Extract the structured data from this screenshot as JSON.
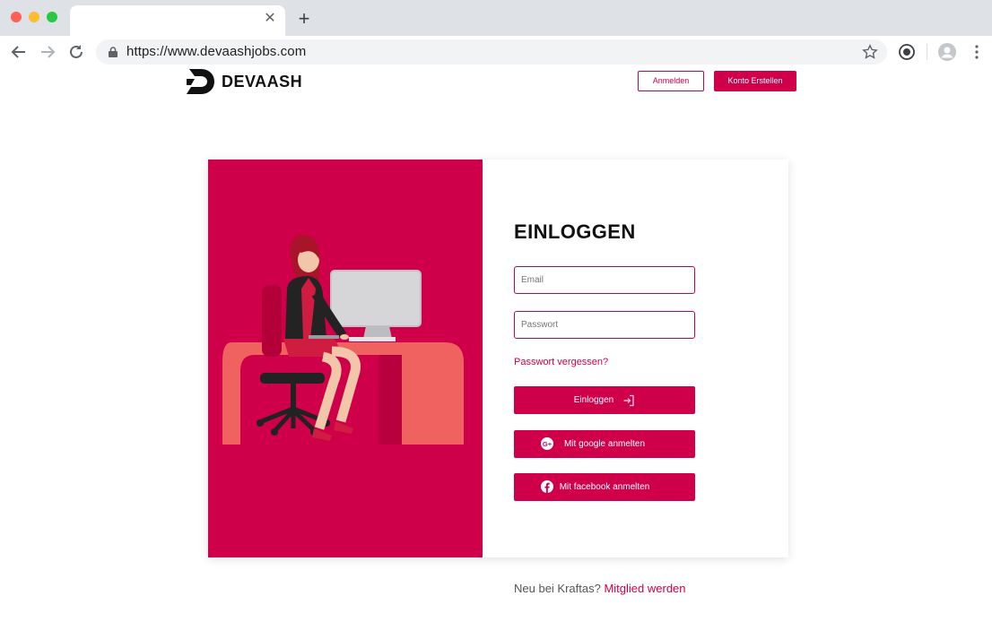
{
  "browser": {
    "url": "https://www.devaashjobs.com"
  },
  "header": {
    "logo_text": "DEVAASH",
    "signin_label": "Anmelden",
    "create_account_label": "Konto Erstellen"
  },
  "login": {
    "title": "EINLOGGEN",
    "email_placeholder": "Email",
    "password_placeholder": "Passwort",
    "forgot_label": "Passwort vergessen?",
    "login_button": "Einloggen",
    "google_button": "Mit google anmelten",
    "facebook_button": "Mit facebook anmelten"
  },
  "footer": {
    "prompt": "Neu bei Kraftas?",
    "link": "Mitglied werden"
  },
  "colors": {
    "brand": "#cf0049",
    "desk": "#f0625f"
  },
  "icons": [
    "lock-icon",
    "star-icon",
    "profile-icon",
    "menu-icon",
    "login-arrow-icon",
    "google-plus-icon",
    "facebook-icon"
  ]
}
